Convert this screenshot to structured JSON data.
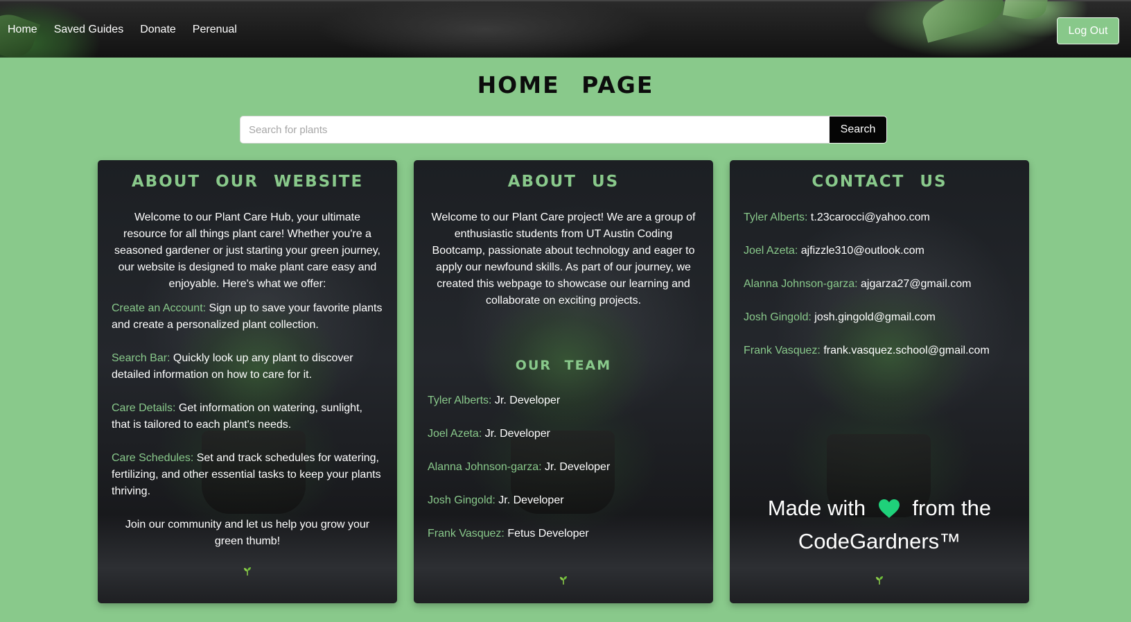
{
  "nav": {
    "links": [
      "Home",
      "Saved Guides",
      "Donate",
      "Perenual"
    ],
    "logout_label": "Log Out"
  },
  "page_title": "HOME PAGE",
  "search": {
    "placeholder": "Search for plants",
    "value": "",
    "button_label": "Search"
  },
  "about_website": {
    "title": "ABOUT OUR WEBSITE",
    "intro": "Welcome to our Plant Care Hub, your ultimate resource for all things plant care! Whether you're a seasoned gardener or just starting your green journey, our website is designed to make plant care easy and enjoyable. Here's what we offer:",
    "features": [
      {
        "label": "Create an Account:",
        "text": " Sign up to save your favorite plants and create a personalized plant collection."
      },
      {
        "label": "Search Bar:",
        "text": " Quickly look up any plant to discover detailed information on how to care for it."
      },
      {
        "label": "Care Details:",
        "text": " Get information on watering, sunlight, that is tailored to each plant's needs."
      },
      {
        "label": "Care Schedules:",
        "text": " Set and track schedules for watering, fertilizing, and other essential tasks to keep your plants thriving."
      }
    ],
    "outro": "Join our community and let us help you grow your green thumb!"
  },
  "about_us": {
    "title": "ABOUT US",
    "intro": "Welcome to our Plant Care project! We are a group of enthusiastic students from UT Austin Coding Bootcamp, passionate about technology and eager to apply our newfound skills. As part of our journey, we created this webpage to showcase our learning and collaborate on exciting projects.",
    "team_title": "OUR TEAM",
    "team": [
      {
        "name": "Tyler Alberts:",
        "role": " Jr. Developer"
      },
      {
        "name": "Joel Azeta:",
        "role": " Jr. Developer"
      },
      {
        "name": "Alanna Johnson-garza:",
        "role": " Jr. Developer"
      },
      {
        "name": "Josh Gingold:",
        "role": " Jr. Developer"
      },
      {
        "name": "Frank Vasquez:",
        "role": " Fetus Developer"
      }
    ]
  },
  "contact_us": {
    "title": "CONTACT US",
    "contacts": [
      {
        "name": "Tyler Alberts:",
        "email": " t.23carocci@yahoo.com"
      },
      {
        "name": "Joel Azeta:",
        "email": " ajfizzle310@outlook.com"
      },
      {
        "name": "Alanna Johnson-garza:",
        "email": " ajgarza27@gmail.com"
      },
      {
        "name": "Josh Gingold:",
        "email": " josh.gingold@gmail.com"
      },
      {
        "name": "Frank Vasquez:",
        "email": " frank.vasquez.school@gmail.com"
      }
    ],
    "made_with_prefix": "Made with",
    "made_with_suffix": "from the",
    "made_with_brand": "CodeGardners™"
  },
  "icons": {
    "heart": "heart-icon",
    "sprout": "sprout-icon"
  },
  "colors": {
    "background": "#89c98b",
    "accent": "#89c98b",
    "heart": "#1fd17a",
    "search_button": "#050505"
  }
}
